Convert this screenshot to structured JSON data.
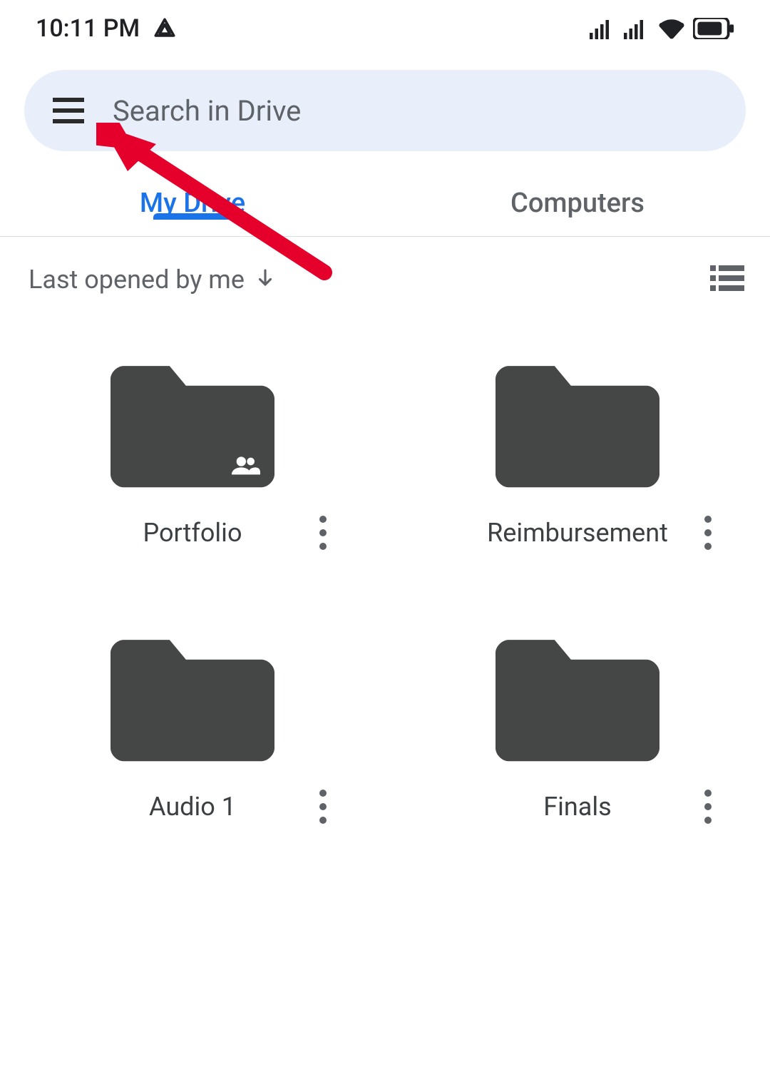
{
  "statusbar": {
    "time": "10:11 PM"
  },
  "search": {
    "placeholder": "Search in Drive"
  },
  "tabs": {
    "my_drive": "My Drive",
    "computers": "Computers"
  },
  "sort": {
    "label": "Last opened by me"
  },
  "items": [
    {
      "name": "Portfolio",
      "shared": true
    },
    {
      "name": "Reimbursement",
      "shared": false
    },
    {
      "name": "Audio 1",
      "shared": false
    },
    {
      "name": "Finals",
      "shared": false
    }
  ]
}
